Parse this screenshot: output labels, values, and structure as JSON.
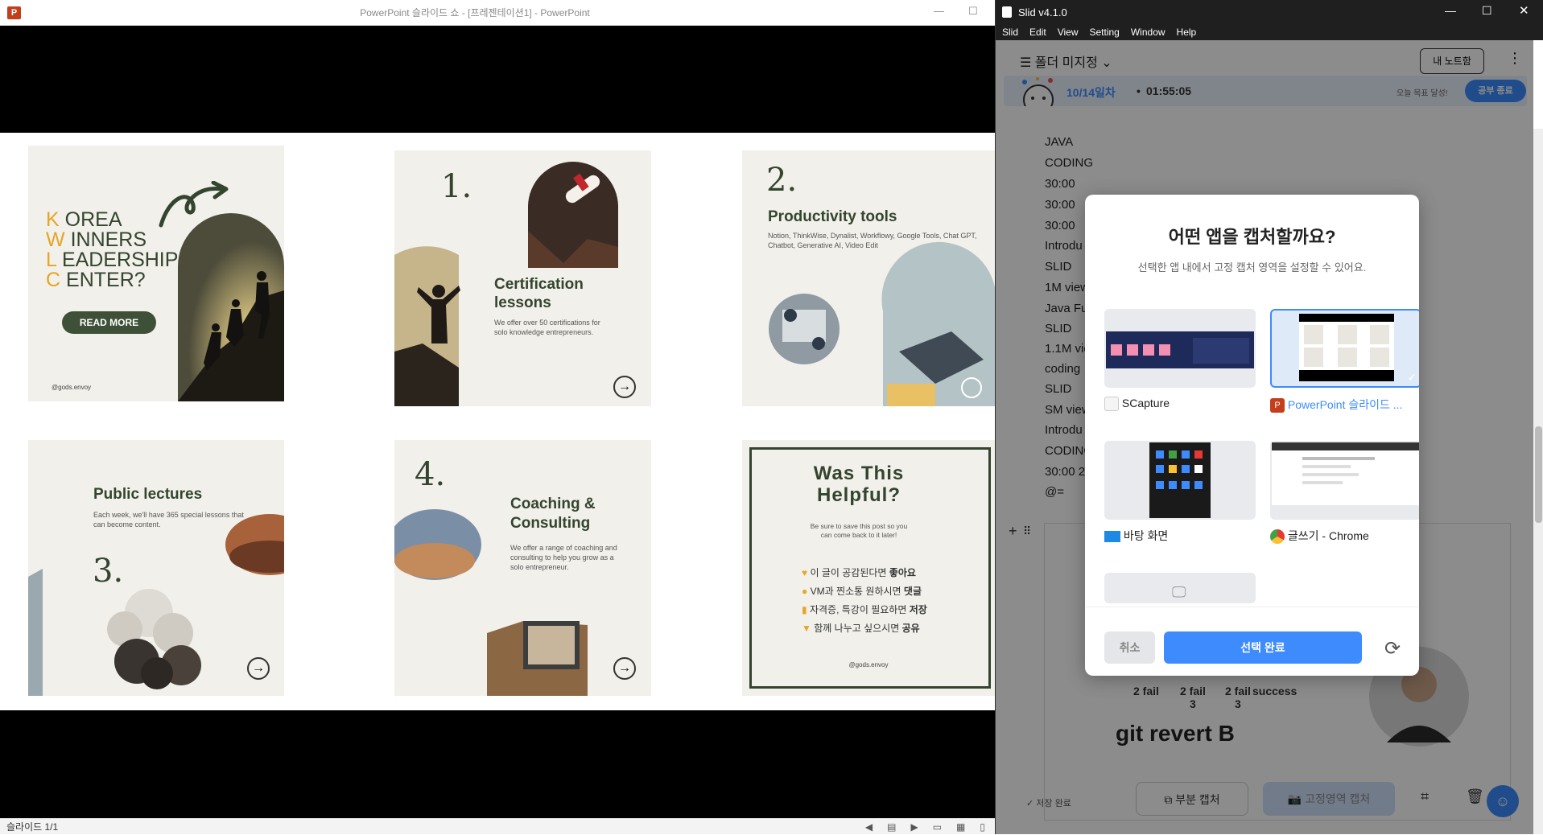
{
  "ppt": {
    "title": "PowerPoint 슬라이드 쇼 - [프레젠테이션1] - PowerPoint",
    "status": "슬라이드 1/1",
    "cards": {
      "c1": {
        "letters": [
          "K",
          "W",
          "L",
          "C"
        ],
        "words": [
          "OREA",
          "INNERS",
          "EADERSHIP",
          "ENTER?"
        ],
        "button": "READ MORE",
        "handle": "@gods.envoy"
      },
      "c2": {
        "number": "1.",
        "title": "Certification lessons",
        "desc": "We offer over 50 certifications for solo knowledge entrepreneurs."
      },
      "c3": {
        "number": "2.",
        "title": "Productivity tools",
        "desc": "Notion, ThinkWise, Dynalist, Workflowy, Google Tools, Chat GPT, Chatbot, Generative AI, Video Edit"
      },
      "c4": {
        "number": "3.",
        "title": "Public lectures",
        "desc": "Each week, we'll have 365 special lessons that can become content."
      },
      "c5": {
        "number": "4.",
        "title": "Coaching & Consulting",
        "desc": "We offer a range of coaching and consulting to help you grow as a solo entrepreneur."
      },
      "c6": {
        "title": "Was This Helpful?",
        "desc": "Be sure to save this post so you can come back to it later!",
        "items": [
          {
            "text": "이 글이 공감된다면 ",
            "bold": "좋아요"
          },
          {
            "text": "VM과 찐소통 원하시면 ",
            "bold": "댓글"
          },
          {
            "text": "자격증, 특강이 필요하면 ",
            "bold": "저장"
          },
          {
            "text": "함께 나누고 싶으시면 ",
            "bold": "공유"
          }
        ],
        "handle": "@gods.envoy"
      }
    }
  },
  "slid": {
    "title": "Slid v4.1.0",
    "menu": [
      "Slid",
      "Edit",
      "View",
      "Setting",
      "Window",
      "Help"
    ],
    "folder": "폴더 미지정",
    "my_note": "내 노트함",
    "day": "10/14일차",
    "timer": "01:55:05",
    "goal": "오늘 목표 달성!",
    "end_study": "공부 종료",
    "note_lines": [
      "JAVA",
      "CODING",
      "30:00",
      "30:00",
      "30:00",
      "Introdu",
      "SLID",
      "1M view",
      "Java Fu",
      "SLID",
      "1.1M vie",
      "coding",
      "SLID",
      "SM view",
      "Introdu",
      "CODING",
      "30:00 2",
      "@="
    ],
    "whiteboard": {
      "labels": [
        "2 fail",
        "2 fail\n3",
        "2 fail\n3",
        "success"
      ],
      "big": "git revert B"
    },
    "saved": "저장 완료",
    "partial_capture": "부분 캡처",
    "fixed_capture": "고정영역 캡처"
  },
  "modal": {
    "title": "어떤 앱을 캡처할까요?",
    "subtitle": "선택한 앱 내에서 고정 캡처 영역을 설정할 수 있어요.",
    "apps": [
      {
        "name": "SCapture",
        "selected": false
      },
      {
        "name": "PowerPoint 슬라이드 ...",
        "selected": true
      },
      {
        "name": "바탕 화면",
        "selected": false
      },
      {
        "name": "글쓰기 - Chrome",
        "selected": false
      }
    ],
    "cancel": "취소",
    "confirm": "선택 완료",
    "accent": "#3d8bfd"
  }
}
